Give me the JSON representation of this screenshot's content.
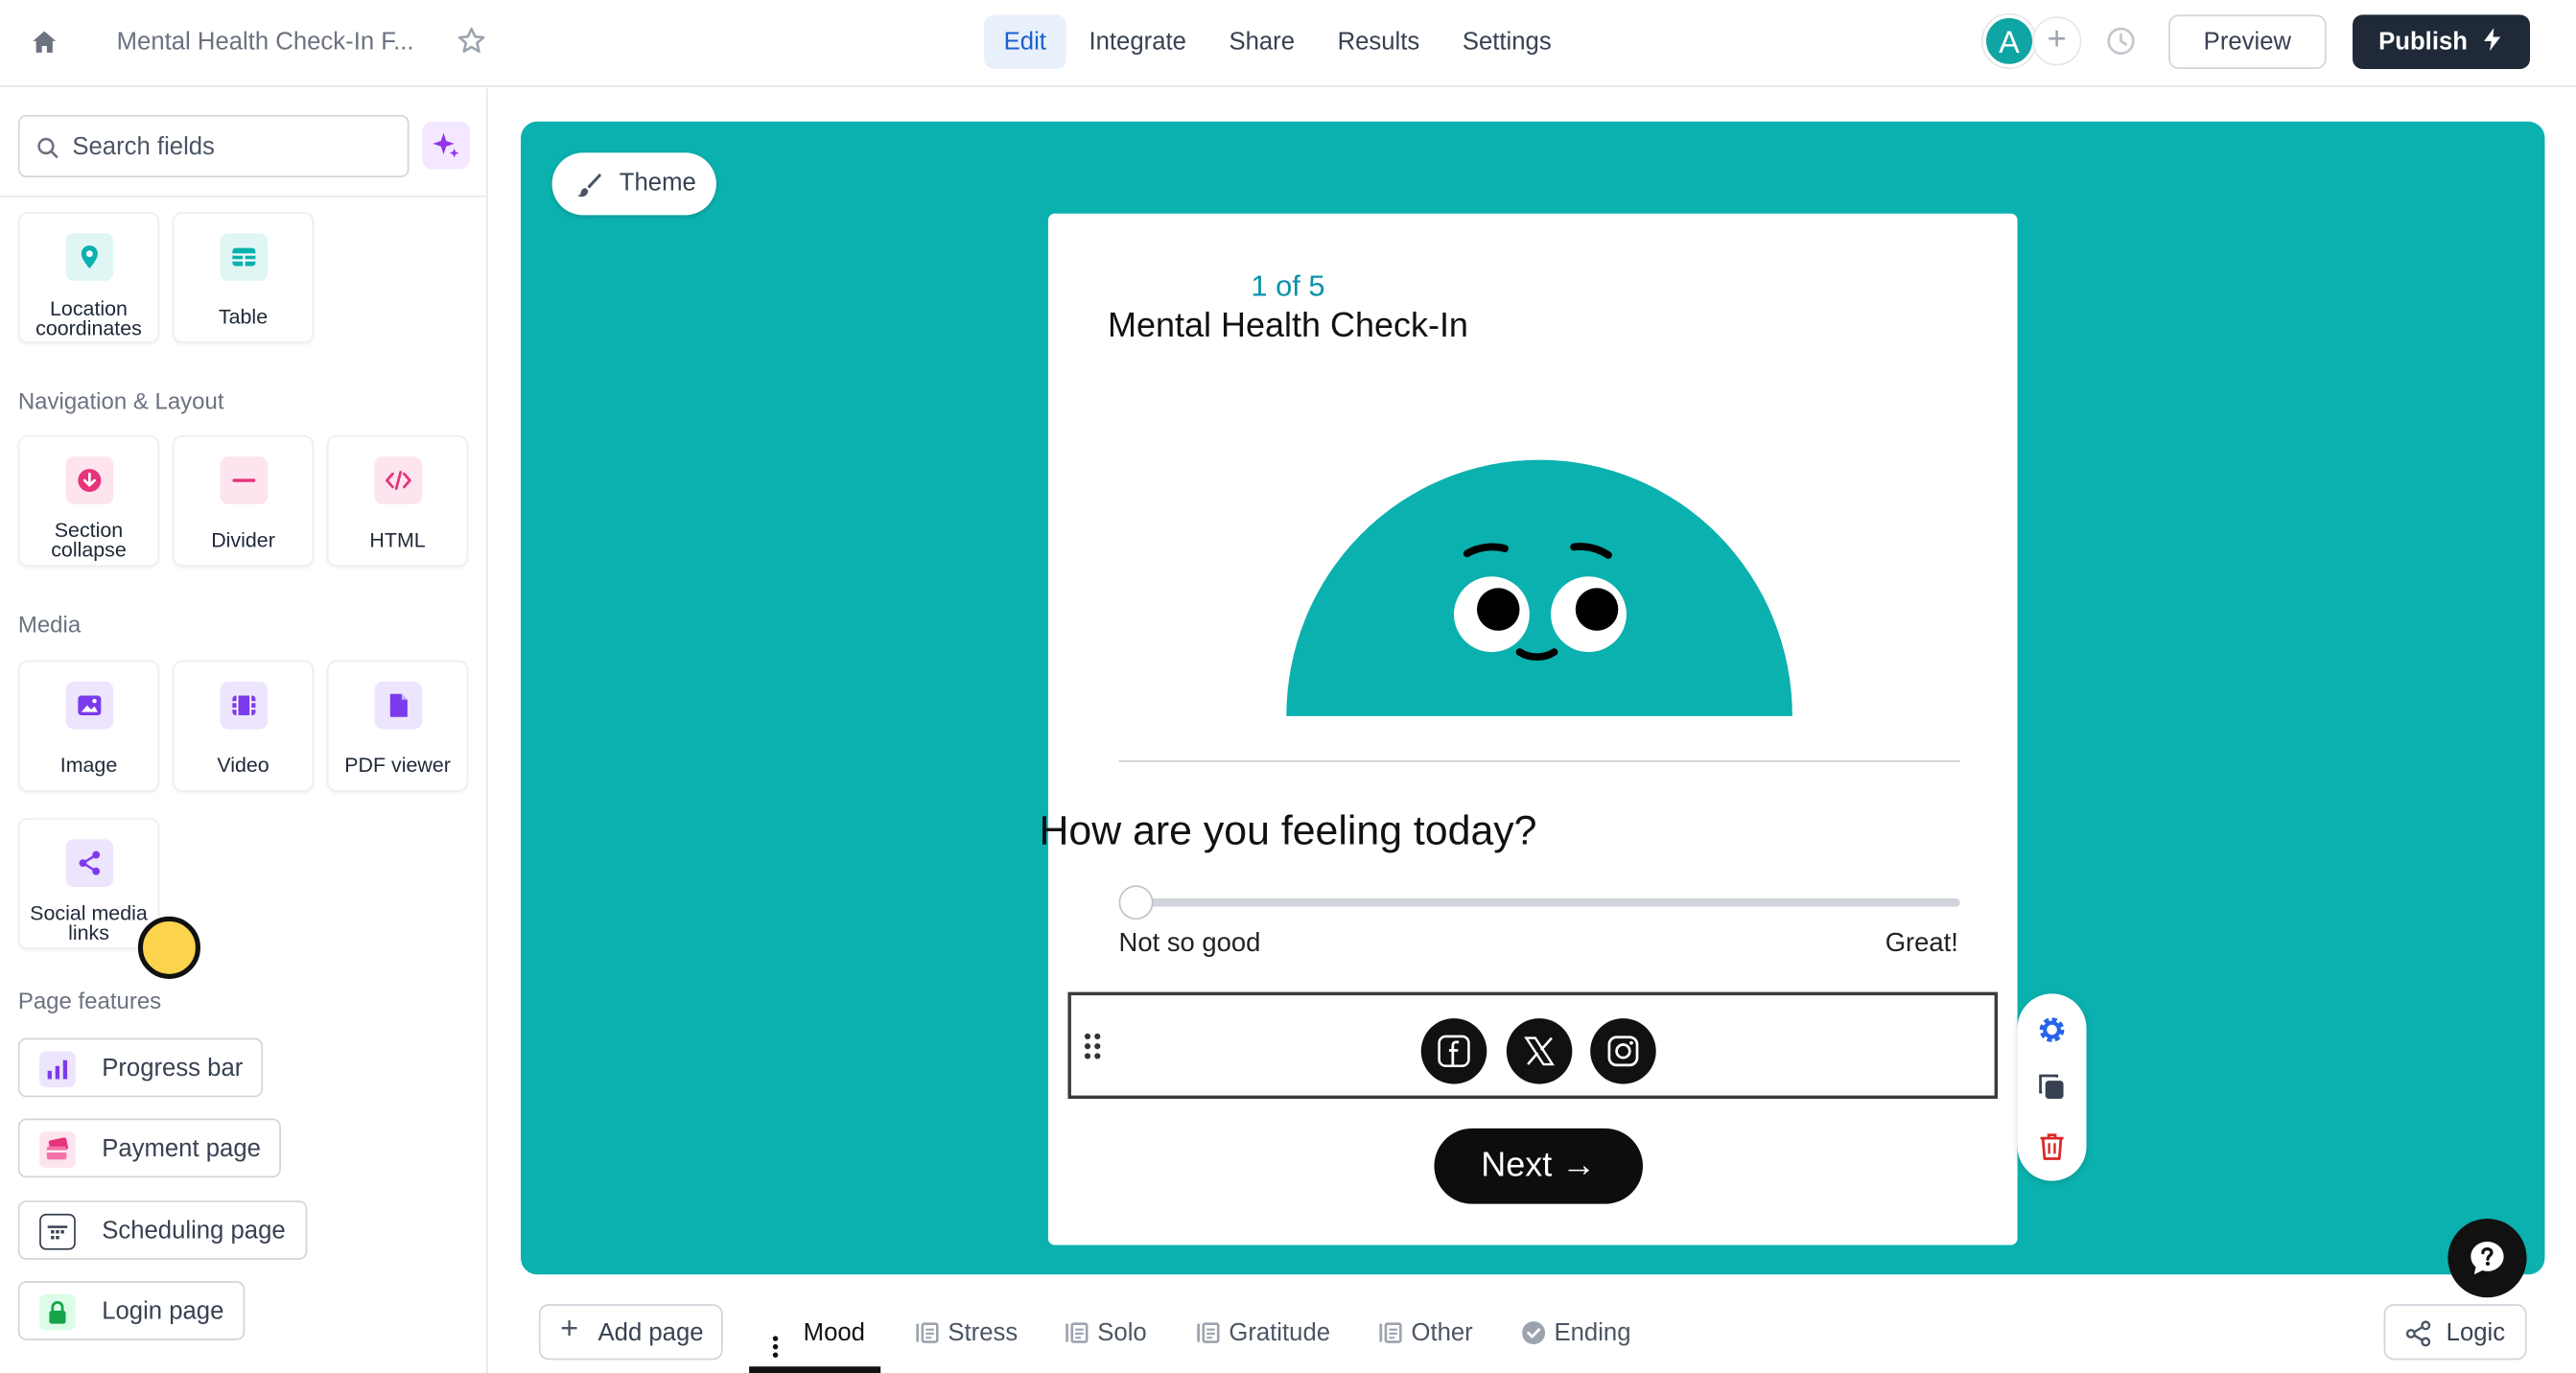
{
  "header": {
    "doc_title": "Mental Health Check-In F...",
    "nav": [
      "Edit",
      "Integrate",
      "Share",
      "Results",
      "Settings"
    ],
    "avatar_letter": "A",
    "add_collaborator": "+",
    "preview_label": "Preview",
    "publish_label": "Publish"
  },
  "sidebar": {
    "search_placeholder": "Search fields",
    "top_cards": [
      {
        "label": "Location coordinates",
        "icon": "location-pin-icon"
      },
      {
        "label": "Table",
        "icon": "table-icon"
      }
    ],
    "nav_layout_heading": "Navigation & Layout",
    "nav_layout_cards": [
      {
        "label": "Section collapse",
        "icon": "collapse-icon"
      },
      {
        "label": "Divider",
        "icon": "divider-icon"
      },
      {
        "label": "HTML",
        "icon": "code-icon"
      }
    ],
    "media_heading": "Media",
    "media_cards": [
      {
        "label": "Image",
        "icon": "image-icon"
      },
      {
        "label": "Video",
        "icon": "video-icon"
      },
      {
        "label": "PDF viewer",
        "icon": "pdf-icon"
      },
      {
        "label": "Social media links",
        "icon": "share-icon"
      }
    ],
    "page_features_heading": "Page features",
    "page_features": [
      {
        "label": "Progress bar",
        "icon": "bar-chart-icon"
      },
      {
        "label": "Payment page",
        "icon": "payment-icon"
      },
      {
        "label": "Scheduling page",
        "icon": "calendar-icon"
      },
      {
        "label": "Login page",
        "icon": "lock-icon"
      }
    ]
  },
  "canvas": {
    "theme_label": "Theme",
    "step_text": "1 of 5",
    "form_title": "Mental Health Check-In",
    "question": "How are you feeling today?",
    "slider_min_label": "Not so good",
    "slider_max_label": "Great!",
    "slider_value": 0,
    "social_icons": [
      "facebook-icon",
      "x-icon",
      "instagram-icon"
    ],
    "next_label": "Next →",
    "accent_color": "#0bb1ae"
  },
  "bottom": {
    "add_page_label": "Add page",
    "pages": [
      "Mood",
      "Stress",
      "Solo",
      "Gratitude",
      "Other",
      "Ending"
    ],
    "active_page": "Mood",
    "logic_label": "Logic"
  }
}
